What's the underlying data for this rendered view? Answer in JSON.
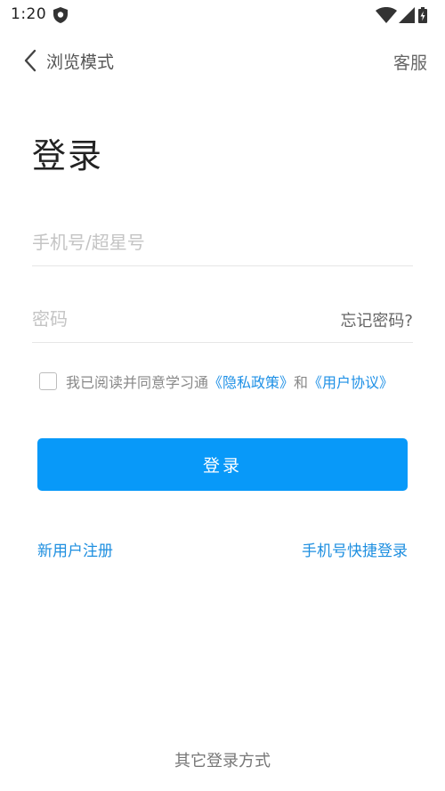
{
  "status_bar": {
    "time": "1:20",
    "icons": [
      "shield-icon",
      "wifi-icon",
      "cell-signal-icon",
      "battery-charging-icon"
    ]
  },
  "nav": {
    "back_label": "浏览模式",
    "service_label": "客服"
  },
  "page_title": "登录",
  "form": {
    "phone_placeholder": "手机号/超星号",
    "phone_value": "",
    "password_placeholder": "密码",
    "password_value": "",
    "forgot_label": "忘记密码?"
  },
  "agreement": {
    "checked": false,
    "prefix": "我已阅读并同意学习通",
    "privacy_link": "《隐私政策》",
    "conjunction": "和",
    "terms_link": "《用户协议》"
  },
  "login_button_label": "登录",
  "register_label": "新用户注册",
  "quick_login_label": "手机号快捷登录",
  "other_login_label": "其它登录方式",
  "colors": {
    "accent": "#0899f9",
    "link": "#1e8fe0",
    "placeholder": "#c4c4c4",
    "divider": "#e6e6e6"
  }
}
